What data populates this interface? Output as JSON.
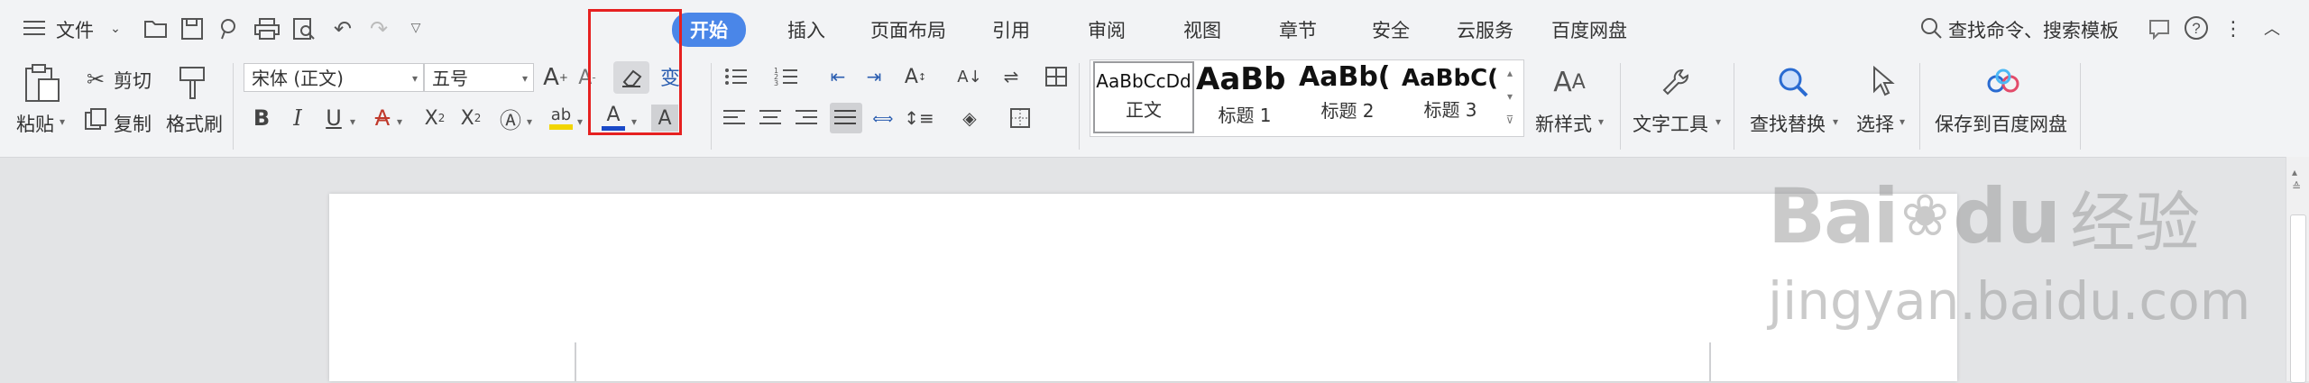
{
  "menubar": {
    "file_label": "文件",
    "tabs": [
      "开始",
      "插入",
      "页面布局",
      "引用",
      "审阅",
      "视图",
      "章节",
      "安全",
      "云服务",
      "百度网盘"
    ],
    "search_text": "查找命令、搜索模板"
  },
  "ribbon": {
    "paste_label": "粘贴",
    "cut_label": "剪切",
    "copy_label": "复制",
    "format_painter_label": "格式刷",
    "font_name": "宋体 (正文)",
    "font_size": "五号",
    "styles": [
      {
        "sample": "AaBbCcDd",
        "label": "正文"
      },
      {
        "sample": "AaBb",
        "label": "标题 1"
      },
      {
        "sample": "AaBb(",
        "label": "标题 2"
      },
      {
        "sample": "AaBbC(",
        "label": "标题 3"
      }
    ],
    "new_style_label": "新样式",
    "text_tools_label": "文字工具",
    "find_replace_label": "查找替换",
    "select_label": "选择",
    "save_baidu_label": "保存到百度网盘"
  },
  "watermark": {
    "brand": "Bai",
    "brand2": "du",
    "cn": "经验",
    "url": "jingyan.baidu.com"
  },
  "colors": {
    "accent": "#4a86e8",
    "highlight_box": "#e62020",
    "font_color_bar": "#1a49c8",
    "highlight_bar": "#f2d500"
  }
}
